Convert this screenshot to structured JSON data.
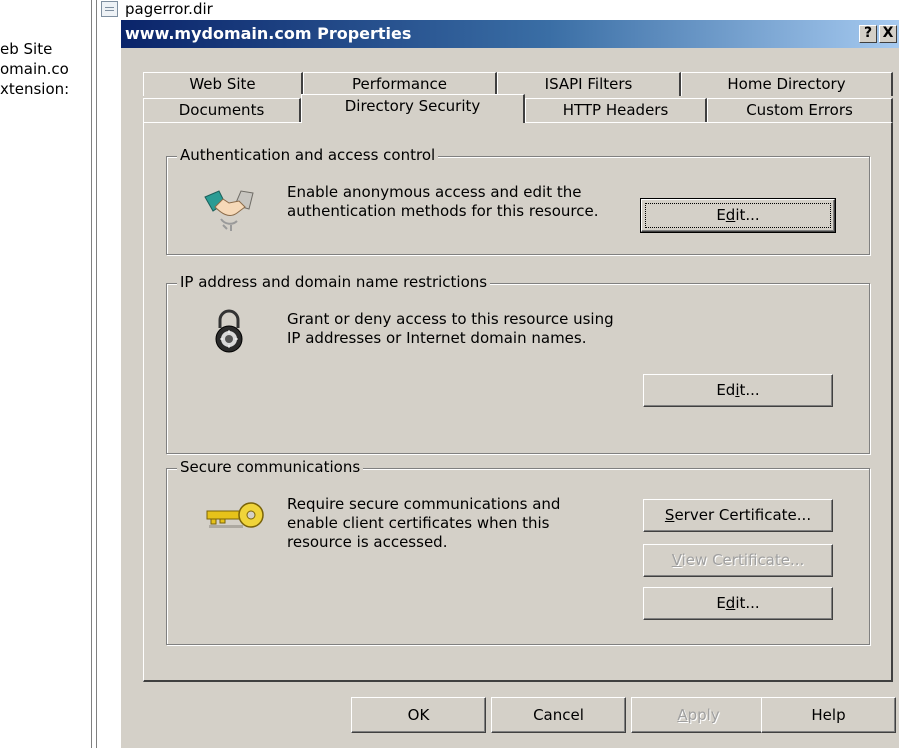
{
  "background": {
    "tree_items": [
      "eb Site",
      "omain.co",
      "xtension:"
    ],
    "file_label": "pagerror.dir"
  },
  "dialog": {
    "title": "www.mydomain.com Properties",
    "help_btn": "?",
    "close_btn": "X"
  },
  "tabs": {
    "row1": [
      "Web Site",
      "Performance",
      "ISAPI Filters",
      "Home Directory"
    ],
    "row2": [
      "Documents",
      "Directory Security",
      "HTTP Headers",
      "Custom Errors"
    ],
    "active": "Directory Security"
  },
  "auth": {
    "legend": "Authentication and access control",
    "line1": "Enable anonymous access and edit the",
    "line2": "authentication methods for this resource.",
    "edit_btn": {
      "pre": "E",
      "key": "d",
      "post": "it..."
    }
  },
  "ip": {
    "legend": "IP address and domain name restrictions",
    "line1": "Grant or deny access to this resource using",
    "line2": "IP addresses or Internet domain names.",
    "edit_btn": {
      "pre": "Ed",
      "key": "i",
      "post": "t..."
    }
  },
  "secure": {
    "legend": "Secure communications",
    "line1": "Require secure communications and",
    "line2": "enable client certificates when this",
    "line3": "resource is accessed.",
    "server_cert_btn": {
      "pre": "",
      "key": "S",
      "post": "erver Certificate..."
    },
    "view_cert_btn": {
      "pre": "",
      "key": "V",
      "post": "iew Certificate..."
    },
    "edit_btn": {
      "pre": "E",
      "key": "d",
      "post": "it..."
    }
  },
  "footer": {
    "ok": "OK",
    "cancel": "Cancel",
    "apply": {
      "pre": "",
      "key": "A",
      "post": "pply"
    },
    "help": "Help"
  },
  "colors": {
    "face": "#d4d0c8",
    "title_start": "#0a246a",
    "title_end": "#a6caf0",
    "disabled_text": "#a0a0a0"
  }
}
